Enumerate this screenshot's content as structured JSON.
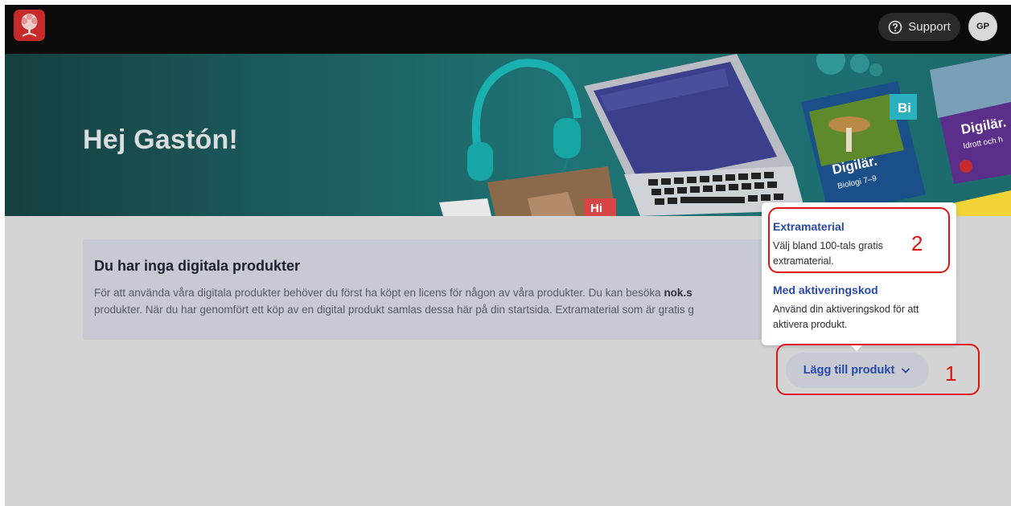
{
  "header": {
    "logo_icon": "tree-logo-icon",
    "support_label": "Support",
    "support_icon": "question-circle-icon",
    "avatar_initials": "GP"
  },
  "hero": {
    "greeting": "Hej Gastón!",
    "book1_brand": "Digilär.",
    "book1_subject": "Biologi 7–9",
    "book1_badge": "Bi",
    "book2_brand": "Digilär.",
    "book2_subject": "Idrott och h",
    "book3_badge": "Hi"
  },
  "notice": {
    "title": "Du har inga digitala produkter",
    "line1_pre": "För att använda våra digitala produkter behöver du först ha köpt en licens för någon av våra produkter. Du kan besöka ",
    "line1_link": "nok.s",
    "line2": "produkter. När du har genomfört ett köp av en digital produkt samlas dessa här på din startsida. Extramaterial som är gratis g"
  },
  "dropdown": {
    "options": [
      {
        "title": "Extramaterial",
        "description": "Välj bland 100-tals gratis extramaterial."
      },
      {
        "title": "Med aktiveringskod",
        "description": "Använd din aktiveringskod för att aktivera produkt."
      }
    ]
  },
  "add_button": {
    "label": "Lägg till produkt",
    "icon": "chevron-down-icon"
  },
  "annotations": {
    "step1": "1",
    "step2": "2",
    "color": "#e01313"
  },
  "colors": {
    "link_blue": "#2848a8",
    "topbar": "#0b0b0b",
    "logo_red": "#c72a2a"
  }
}
